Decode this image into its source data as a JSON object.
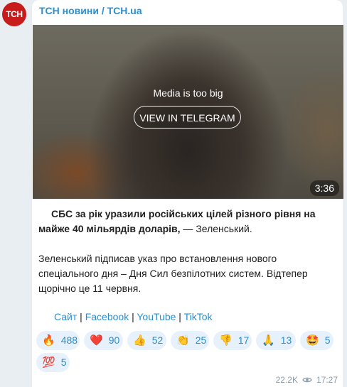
{
  "channel": {
    "avatar_text": "ТСН",
    "name": "ТСН новини / TCH.ua"
  },
  "media": {
    "message": "Media is too big",
    "button_label": "VIEW IN TELEGRAM",
    "duration": "3:36"
  },
  "post": {
    "lead_bold": "СБС за рік уразили російських цілей різного рівня на майже 40 мільярдів доларів,",
    "lead_rest": " — Зеленський.",
    "para2": "Зеленський підписав указ про встановлення нового спеціального дня – Дня Сил безпілотних систем. Відтепер щорічно це 11 червня."
  },
  "links": {
    "site": "Сайт",
    "sep1": " | ",
    "facebook": "Facebook",
    "sep2": " | ",
    "youtube": "YouTube",
    "sep3": " | ",
    "tiktok": "TikTok"
  },
  "reactions": [
    {
      "icon": "fire-icon",
      "emoji": "🔥",
      "count": "488"
    },
    {
      "icon": "red-heart-icon",
      "emoji": "❤️",
      "count": "90"
    },
    {
      "icon": "thumbs-up-icon",
      "emoji": "👍",
      "count": "52"
    },
    {
      "icon": "clapping-hands-icon",
      "emoji": "👏",
      "count": "25"
    },
    {
      "icon": "thumbs-down-icon",
      "emoji": "👎",
      "count": "17"
    },
    {
      "icon": "folded-hands-icon",
      "emoji": "🙏",
      "count": "13"
    },
    {
      "icon": "star-struck-icon",
      "emoji": "🤩",
      "count": "5"
    },
    {
      "icon": "hundred-points-icon",
      "emoji": "💯",
      "count": "5"
    }
  ],
  "meta": {
    "views": "22.2K",
    "time": "17:27"
  },
  "colors": {
    "accent": "#2a8fd1",
    "avatar_bg": "#c81b1b",
    "reaction_bg": "#e7f1fb",
    "page_bg": "#e8eef2"
  }
}
